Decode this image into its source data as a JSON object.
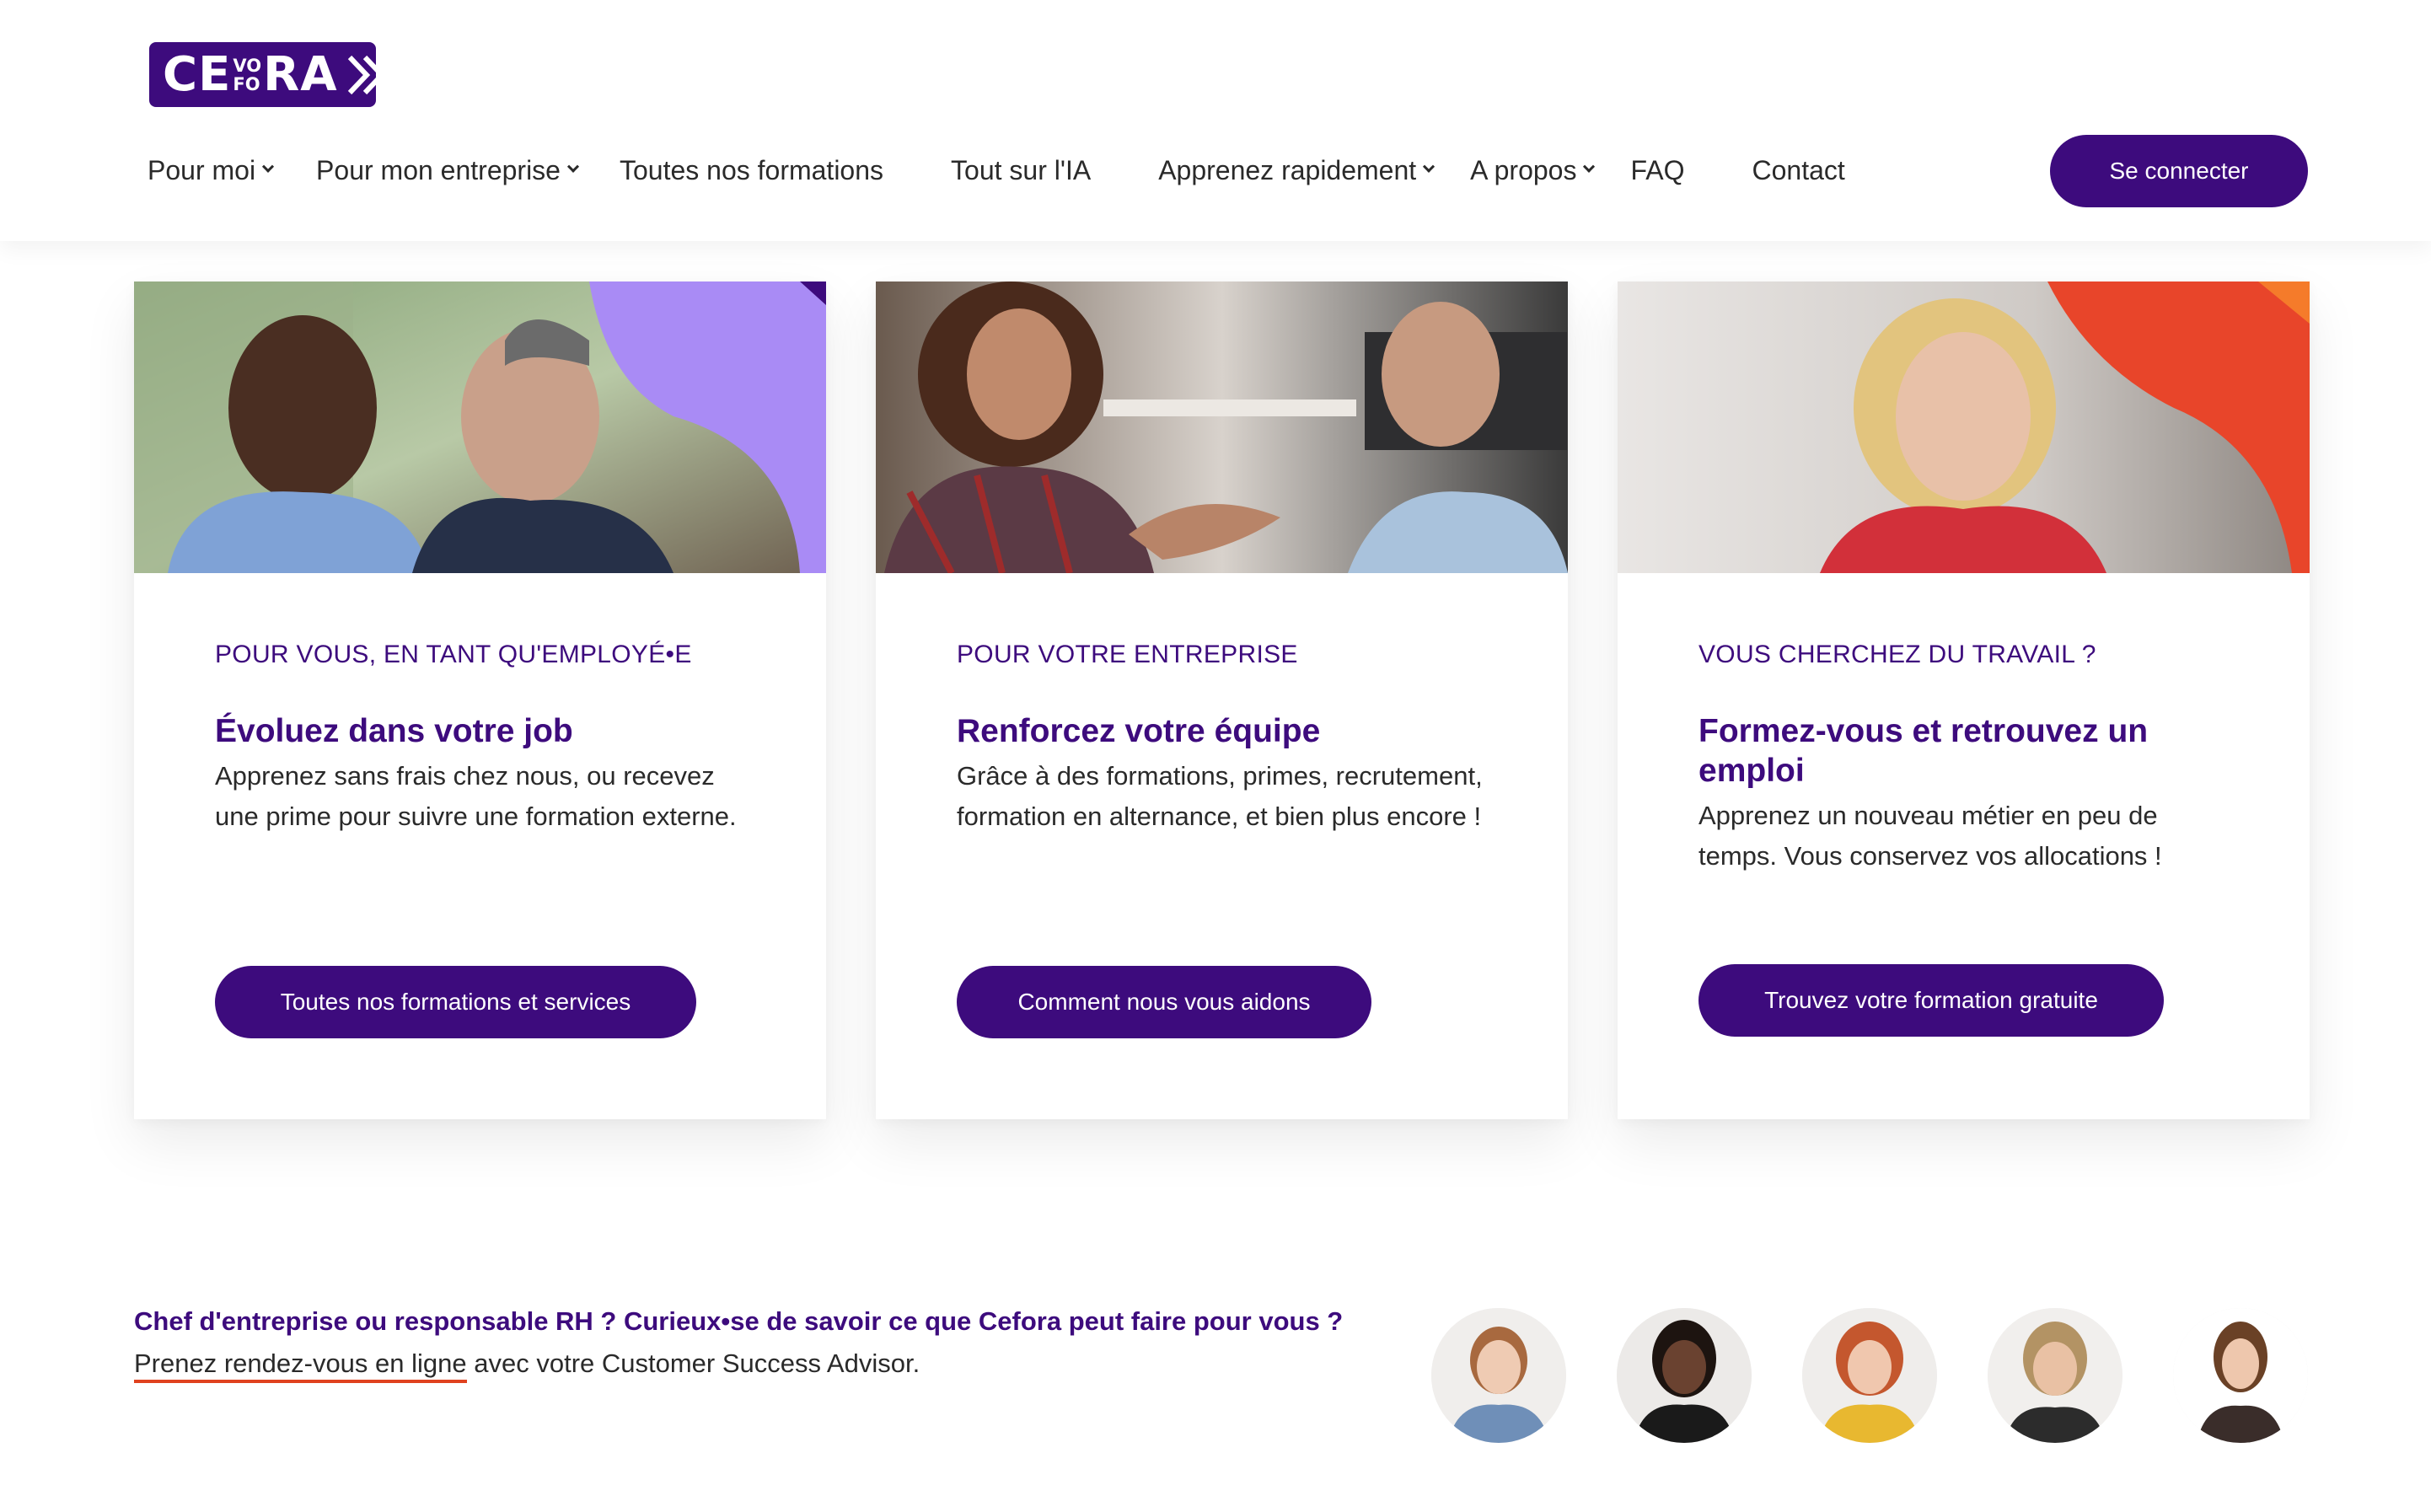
{
  "header": {
    "logo": {
      "left": "CE",
      "stack_top": "VO",
      "stack_bottom": "FO",
      "right": "RA"
    },
    "nav": [
      {
        "label": "Pour moi",
        "dropdown": true
      },
      {
        "label": "Pour mon entreprise",
        "dropdown": true
      },
      {
        "label": "Toutes nos formations",
        "dropdown": false
      },
      {
        "label": "Tout sur l'IA",
        "dropdown": false
      },
      {
        "label": "Apprenez rapidement",
        "dropdown": true
      },
      {
        "label": "A propos",
        "dropdown": true
      },
      {
        "label": "FAQ",
        "dropdown": false
      },
      {
        "label": "Contact",
        "dropdown": false
      }
    ],
    "login_label": "Se connecter"
  },
  "cards": [
    {
      "eyebrow": "POUR VOUS, EN TANT QU'EMPLOYÉ•E",
      "title": "Évoluez dans votre job",
      "text": "Apprenez sans frais chez nous, ou recevez une prime pour suivre une formation externe.",
      "button": "Toutes nos formations et services"
    },
    {
      "eyebrow": "POUR VOTRE ENTREPRISE",
      "title": "Renforcez votre équipe",
      "text": "Grâce à des formations, primes, recrutement, formation en alternance, et bien plus encore !",
      "button": "Comment nous vous aidons"
    },
    {
      "eyebrow": "VOUS CHERCHEZ DU TRAVAIL ?",
      "title": "Formez-vous et retrouvez un emploi",
      "text": "Apprenez un nouveau métier en peu de temps. Vous conservez vos allocations !",
      "button": "Trouvez votre formation gratuite"
    }
  ],
  "cta": {
    "title": "Chef d'entreprise ou responsable RH ? Curieux•se de savoir ce que Cefora peut faire pour vous ?",
    "link": "Prenez rendez-vous en ligne",
    "rest": " avec votre Customer Success Advisor."
  },
  "colors": {
    "brand": "#3d0b7d",
    "accent_purple": "#a98bf5",
    "accent_orange": "#e8452a",
    "underline": "#e0421f"
  }
}
